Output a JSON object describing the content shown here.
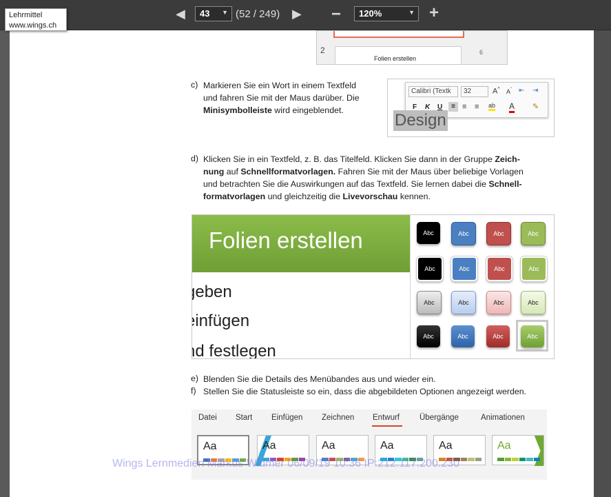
{
  "toolbar": {
    "page_value": "43",
    "page_count": "(52 / 249)",
    "zoom_value": "120%",
    "zoom_out": "−",
    "zoom_in": "+"
  },
  "tag": {
    "line1": "Lehrmittel",
    "line2": "www.wings.ch"
  },
  "top_fig": {
    "slide_number": "2",
    "slide_title": "Folien erstellen",
    "side_digit": "6"
  },
  "items": {
    "c_label": "c)",
    "c_text1": "Markieren Sie ein Wort in einem Textfeld",
    "c_text2": "und fahren Sie mit der Maus darüber. Die",
    "c_text3_b": "Minisymbolleiste",
    "c_text3": " wird eingeblendet.",
    "d_label": "d)",
    "d_l1": "Klicken Sie in ein Textfeld, z. B. das Titelfeld. Klicken Sie dann in der Gruppe ",
    "d_l1_b": "Zeich-",
    "d_l2_b1": "nung",
    "d_l2_a": " auf ",
    "d_l2_b2": "Schnellformatvorlagen.",
    "d_l2_c": " Fahren Sie mit der Maus über beliebige Vorlagen",
    "d_l3": "und betrachten Sie die Auswirkungen auf das Textfeld. Sie lernen dabei die ",
    "d_l3_b": "Schnell-",
    "d_l4_b1": "formatvorlagen",
    "d_l4_a": " und gleichzeitig die ",
    "d_l4_b2": "Livevorschau",
    "d_l4_c": " kennen.",
    "e_label": "e)",
    "e_text": "Blenden Sie die Details des Menübandes aus und wieder ein.",
    "f_label": "f)",
    "f_text": "Stellen Sie die Statusleiste so ein, dass die abgebildeten Optionen angezeigt werden."
  },
  "minitoolbar": {
    "font": "Calibri (Textk",
    "size": "32",
    "bold": "F",
    "italic": "K",
    "underline": "U",
    "word": "Design"
  },
  "slide_fig": {
    "title": "Folien erstellen",
    "line1": "geben",
    "line2": "einfügen",
    "line3": "nd festlegen",
    "swatch_label": "Abc"
  },
  "ribbon": {
    "tabs": [
      "Datei",
      "Start",
      "Einfügen",
      "Zeichnen",
      "Entwurf",
      "Übergänge",
      "Animationen"
    ],
    "theme_label": "Aa"
  },
  "watermark": "Wings Lernmedien Markus Widmer 06/09/19 10:36 IP:212.117.200.230",
  "colors": {
    "accent_green": "#7aae3a",
    "slide_border": "#e8694f",
    "underline_red": "#d24726"
  }
}
